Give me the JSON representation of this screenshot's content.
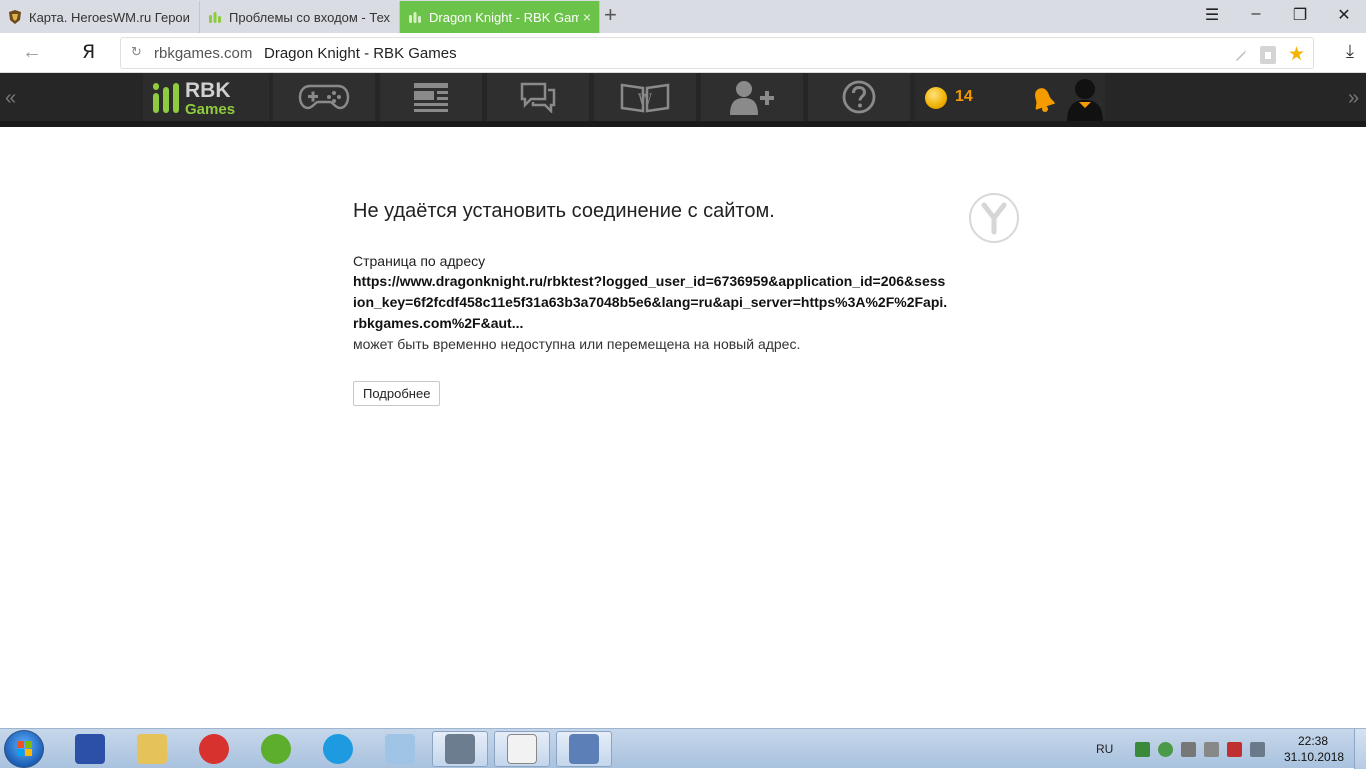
{
  "browser": {
    "tabs": [
      {
        "title": "Карта. HeroesWM.ru Герои",
        "active": false
      },
      {
        "title": "Проблемы со входом - Тех",
        "active": false
      },
      {
        "title": "Dragon Knight - RBK Gam",
        "active": true
      }
    ],
    "tab_close": "×",
    "new_tab": "+",
    "window_controls": {
      "menu": "☰",
      "minimize": "–",
      "maximize": "❐",
      "close": "✕"
    }
  },
  "addressbar": {
    "back": "←",
    "ya_button": "Я",
    "reload": "↻",
    "domain": "rbkgames.com",
    "page_title": "Dragon Knight - RBK Games",
    "star": "★",
    "download": "⤓"
  },
  "rbk": {
    "left_arrow": "«",
    "right_arrow": "»",
    "logo_top": "RBK",
    "logo_bottom": "Games",
    "coins": "14",
    "icons": [
      "gamepad-icon",
      "news-icon",
      "chat-icon",
      "wiki-icon",
      "add-friend-icon",
      "help-icon",
      "coin-icon",
      "bell-icon",
      "avatar-icon"
    ]
  },
  "error": {
    "heading": "Не удаётся установить соединение с сайтом.",
    "lead": "Страница по адресу",
    "url": "https://www.dragonknight.ru/rbktest?logged_user_id=6736959&application_id=206&session_key=6f2fcdf458c11e5f31a63b3a7048b5e6&lang=ru&api_server=https%3A%2F%2Fapi.rbkgames.com%2F&aut...",
    "tail": "может быть временно недоступна или перемещена на новый адрес.",
    "more_button": "Подробнее"
  },
  "taskbar": {
    "language": "RU",
    "time": "22:38",
    "date": "31.10.2018",
    "colors": {
      "start": "#1b5fb5",
      "active_tab": "#6cc34a",
      "rbk_green": "#8ecb3e",
      "coins": "#f59b00"
    }
  }
}
